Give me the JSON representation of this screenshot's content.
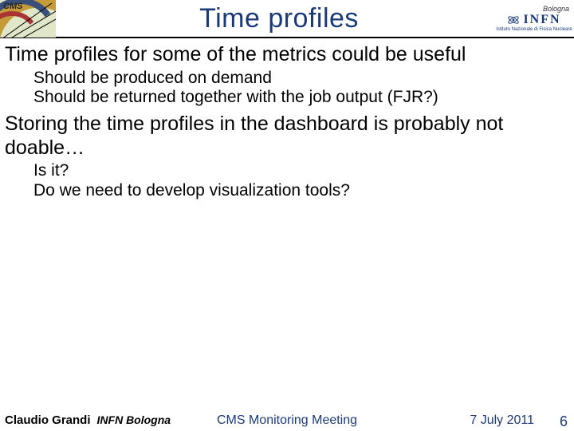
{
  "header": {
    "title": "Time profiles",
    "left_logo_label": "CMS",
    "right_logo_city": "Bologna",
    "right_logo_text": "INFN",
    "right_logo_sub": "Istituto Nazionale di Fisica Nucleare"
  },
  "body": {
    "line1": "Time profiles for some of the metrics could be useful",
    "line1_sub1": "Should be produced on demand",
    "line1_sub2": "Should be returned together with the job output (FJR?)",
    "line2": "Storing the time profiles in the dashboard is probably not doable…",
    "line2_sub1": "Is it?",
    "line2_sub2": "Do we need to develop visualization tools?"
  },
  "footer": {
    "author": "Claudio Grandi",
    "affiliation": "INFN Bologna",
    "meeting": "CMS Monitoring Meeting",
    "date": "7 July 2011",
    "page": "6"
  }
}
